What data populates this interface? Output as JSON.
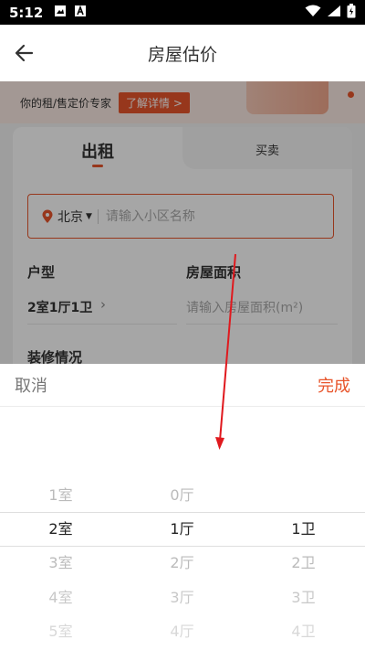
{
  "status_bar": {
    "time": "5:12"
  },
  "header": {
    "title": "房屋估价"
  },
  "banner": {
    "text": "你的租/售定价专家",
    "link_label": "了解详情 >"
  },
  "tabs": [
    {
      "label": "出租",
      "active": true
    },
    {
      "label": "买卖",
      "active": false
    }
  ],
  "search": {
    "city": "北京",
    "placeholder": "请输入小区名称"
  },
  "fields": {
    "layout_label": "户型",
    "layout_value": "2室1厅1卫",
    "area_label": "房屋面积",
    "area_placeholder": "请输入房屋面积(m²)",
    "decor_label": "装修情况"
  },
  "picker": {
    "cancel_label": "取消",
    "done_label": "完成",
    "rooms": [
      "1室",
      "2室",
      "3室",
      "4室",
      "5室"
    ],
    "halls": [
      "0厅",
      "1厅",
      "2厅",
      "3厅",
      "4厅"
    ],
    "baths": [
      "",
      "1卫",
      "2卫",
      "3卫",
      "4卫"
    ],
    "selected": {
      "rooms": "2室",
      "halls": "1厅",
      "baths": "1卫"
    }
  },
  "colors": {
    "accent": "#e8552b",
    "annotation_arrow": "#e0191e"
  }
}
